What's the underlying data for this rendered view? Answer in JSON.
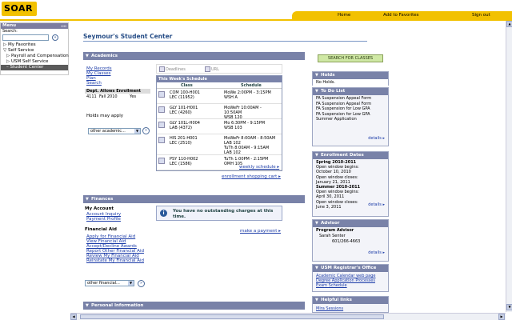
{
  "header": {
    "logo": "SOAR",
    "links": [
      "Home",
      "Add to Favorites",
      "Sign out"
    ]
  },
  "menu": {
    "title": "Menu",
    "search_label": "Search:",
    "go": "»",
    "items": [
      "My Favorites",
      "Self Service",
      "Payroll and Compensation",
      "USM Self Service",
      "Student Center"
    ]
  },
  "page_title": "Seymour's Student Center",
  "academics": {
    "header": "Academics",
    "links": [
      "My Records",
      "My Classes",
      "Plan",
      "Search"
    ],
    "tabs": [
      "Deadlines",
      "URL"
    ],
    "dept_header": "Dept. Allows Enrollment",
    "dept_row": [
      "4111",
      "Fall 2010",
      "Yes"
    ],
    "holds_label": "Holds may apply",
    "select_value": "other academic...",
    "schedule_title": "This Week's Schedule",
    "col_class": "Class",
    "col_schedule": "Schedule",
    "rows": [
      {
        "cls": [
          "COM 100-H001",
          "LEC (11952)"
        ],
        "sch": [
          "MoWe 2:00PM - 3:15PM",
          "WSH A"
        ]
      },
      {
        "cls": [
          "GLY 101-H001",
          "LEC (4260)"
        ],
        "sch": [
          "MoWeFr 10:00AM -",
          "10:50AM",
          "WSB 120"
        ]
      },
      {
        "cls": [
          "GLY 101L-H004",
          "LAB (4372)"
        ],
        "sch": [
          "Mo 6:30PM - 9:15PM",
          "WSB 103"
        ]
      },
      {
        "cls": [
          "HIS 201-H001",
          "LEC (2510)"
        ],
        "sch": [
          "MoWeFr 8:00AM - 8:50AM",
          "LAB 102",
          "TuTh 8:00AM - 9:15AM",
          "LAB 102"
        ]
      },
      {
        "cls": [
          "PSY 110-H002",
          "LEC (1586)"
        ],
        "sch": [
          "TuTh 1:00PM - 2:15PM",
          "OMH 105"
        ]
      }
    ],
    "weekly_link": "weekly schedule",
    "cart_link": "enrollment shopping cart"
  },
  "finances": {
    "header": "Finances",
    "my_account": "My Account",
    "account_links": [
      "Account Inquiry",
      "Payment Profile"
    ],
    "financial_aid": "Financial Aid",
    "aid_links": [
      "Apply for Financial Aid",
      "View Financial Aid",
      "Accept/Decline Awards",
      "Report Other Financial Aid",
      "Review My Financial Aid",
      "Reinstate My Financial Aid"
    ],
    "make_payment": "make a payment",
    "message": [
      "You have no outstanding charges at this",
      "time."
    ],
    "select_value": "other financial..."
  },
  "personal": {
    "header": "Personal Information"
  },
  "right": {
    "search_button": "SEARCH FOR CLASSES",
    "holds": {
      "header": "Holds",
      "text": "No Holds."
    },
    "todo": {
      "header": "To Do List",
      "items": [
        "FA Suspension Appeal Form",
        "FA Suspension Appeal Form",
        "FA Suspension for Low GPA",
        "FA Suspension for Low GPA",
        "Summer Application"
      ],
      "details": "details"
    },
    "enroll": {
      "header": "Enrollment Dates",
      "lines": [
        "Spring 2010-2011",
        "Open window begins:",
        "October 10, 2010",
        "Open window closes:",
        "January 21, 2011",
        "Summer 2010-2011",
        "Open window begins:",
        "April 30, 2011",
        "Open window closes:",
        "June 3, 2011"
      ],
      "details": "details"
    },
    "advisor": {
      "header": "Advisor",
      "lines": [
        "Program Advisor",
        "Sarah Senter",
        "601/266-4663"
      ],
      "details": "details"
    },
    "registrar": {
      "header": "USM Registrar's Office",
      "links": [
        "Academic Calendar web page",
        "Degree Application Processes",
        "Exam Schedule"
      ]
    },
    "helpful": {
      "header": "Helpful links",
      "links": [
        "Mira Sessions"
      ]
    }
  }
}
